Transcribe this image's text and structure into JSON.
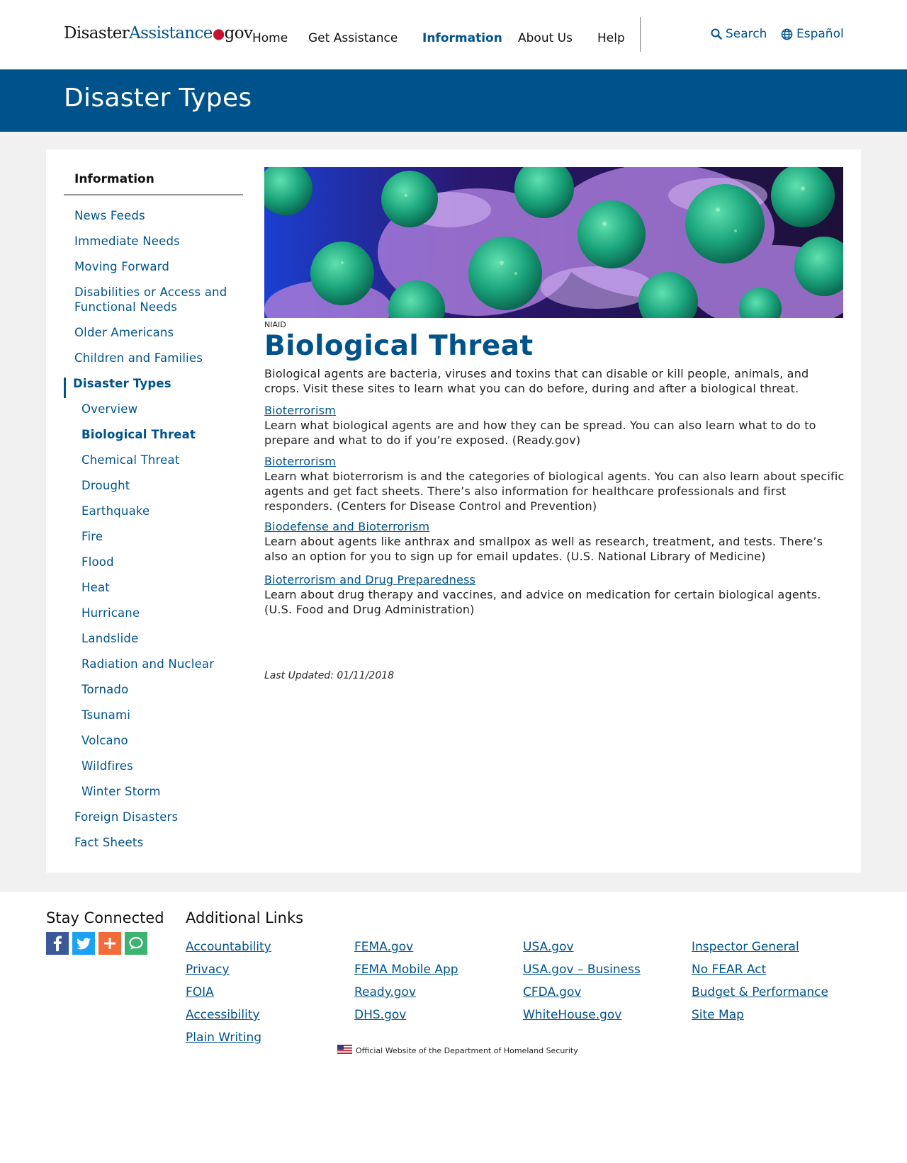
{
  "header": {
    "logo": {
      "part1": "Disaster",
      "part2": "Assistance",
      "dot": "●",
      "part3": "gov"
    },
    "nav": [
      "Home",
      "Get Assistance",
      "Information",
      "About Us",
      "Help"
    ],
    "active_nav": "Information",
    "search_label": "Search",
    "language_label": "Español"
  },
  "banner": {
    "title": "Disaster Types"
  },
  "sidebar": {
    "title": "Information",
    "items": [
      {
        "label": "News Feeds"
      },
      {
        "label": "Immediate Needs"
      },
      {
        "label": "Moving Forward"
      },
      {
        "label": "Disabilities or Access and Functional Needs"
      },
      {
        "label": "Older Americans"
      },
      {
        "label": "Children and Families"
      },
      {
        "label": "Disaster Types"
      },
      {
        "label": "Overview"
      },
      {
        "label": "Biological Threat"
      },
      {
        "label": "Chemical Threat"
      },
      {
        "label": "Drought"
      },
      {
        "label": "Earthquake"
      },
      {
        "label": "Fire"
      },
      {
        "label": "Flood"
      },
      {
        "label": "Heat"
      },
      {
        "label": "Hurricane"
      },
      {
        "label": "Landslide"
      },
      {
        "label": "Radiation and Nuclear"
      },
      {
        "label": "Tornado"
      },
      {
        "label": "Tsunami"
      },
      {
        "label": "Volcano"
      },
      {
        "label": "Wildfires"
      },
      {
        "label": "Winter Storm"
      },
      {
        "label": "Foreign Disasters"
      },
      {
        "label": "Fact Sheets"
      }
    ]
  },
  "content": {
    "image_credit": "NIAID",
    "title": "Biological Threat",
    "intro": "Biological agents are bacteria, viruses and toxins that can disable or kill people, animals, and crops. Visit these sites to learn what you can do before, during and after a biological threat.",
    "resources": [
      {
        "link": "Bioterrorism",
        "desc": "Learn what biological agents are and how they can be spread. You can also learn what to do to prepare and what to do if you’re exposed. (Ready.gov)"
      },
      {
        "link": "Bioterrorism",
        "desc": "Learn what bioterrorism is and the categories of biological agents. You can also learn about specific agents and get fact sheets. There’s also information for healthcare professionals and first responders. (Centers for Disease Control and Prevention)"
      },
      {
        "link": "Biodefense and Bioterrorism",
        "desc": "Learn about agents like anthrax and smallpox as well as research, treatment, and tests. There’s also an option for you to sign up for email updates. (U.S. National Library of Medicine)"
      },
      {
        "link": "Bioterrorism and Drug Preparedness",
        "desc": "Learn about drug therapy and vaccines, and advice on medication for certain biological agents. (U.S. Food and Drug Administration)"
      }
    ],
    "last_updated": "Last Updated: 01/11/2018"
  },
  "footer": {
    "stay_connected": "Stay Connected",
    "social_icons": [
      "facebook-icon",
      "twitter-icon",
      "share-plus-icon",
      "chat-icon"
    ],
    "additional_links_title": "Additional Links",
    "col1": [
      "Accountability",
      "Privacy",
      "FOIA",
      "Accessibility",
      "Plain Writing"
    ],
    "col2": [
      "FEMA.gov",
      "FEMA Mobile App",
      "Ready.gov",
      "DHS.gov"
    ],
    "col3": [
      "USA.gov",
      "USA.gov – Business",
      "CFDA.gov",
      "WhiteHouse.gov"
    ],
    "col4": [
      "Inspector General",
      "No FEAR Act",
      "Budget & Performance",
      "Site Map"
    ],
    "official_text": "Official Website of the Department of Homeland Security"
  },
  "colors": {
    "primary": "#00538a",
    "accent_red": "#c41230",
    "page_bg": "#f1f1f1"
  }
}
